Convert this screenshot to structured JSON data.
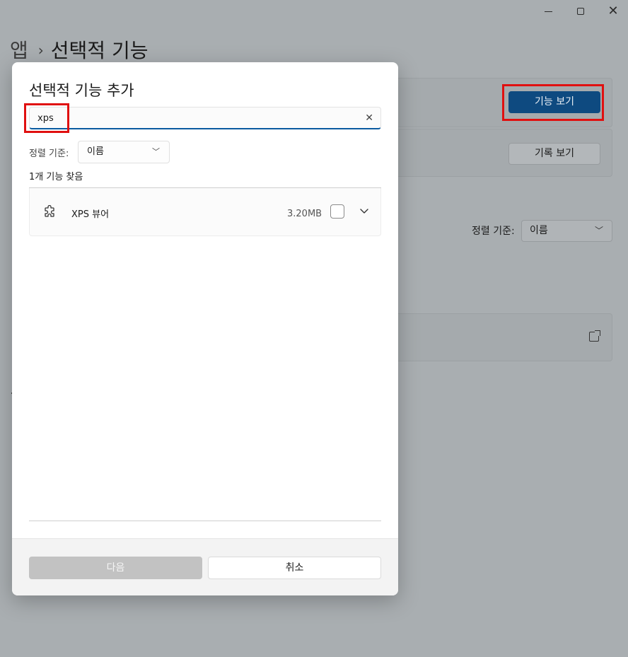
{
  "window": {
    "controls": {
      "minimize": "—",
      "maximize": "☐",
      "close": "✕"
    }
  },
  "background": {
    "breadcrumb": {
      "parent": "앱",
      "separator": "›",
      "current": "선택적 기능"
    },
    "view_features_button": "기능 보기",
    "view_history_button": "기록 보기",
    "sort_label": "정렬 기준:",
    "sort_value": "이름",
    "open_external_icon": "open-external-icon"
  },
  "dialog": {
    "title": "선택적 기능 추가",
    "search": {
      "value": "xps",
      "placeholder": ""
    },
    "sort_label": "정렬 기준:",
    "sort_value": "이름",
    "results_count": "1개 기능 찾음",
    "features": [
      {
        "name": "XPS 뷰어",
        "size": "3.20MB",
        "checked": false,
        "icon": "puzzle-icon"
      }
    ],
    "buttons": {
      "next": "다음",
      "cancel": "취소"
    }
  },
  "colors": {
    "accent": "#0e4a80",
    "search_underline": "#0a5aa0",
    "highlight": "#e01010",
    "disabled_button": "#c2c2c2"
  }
}
